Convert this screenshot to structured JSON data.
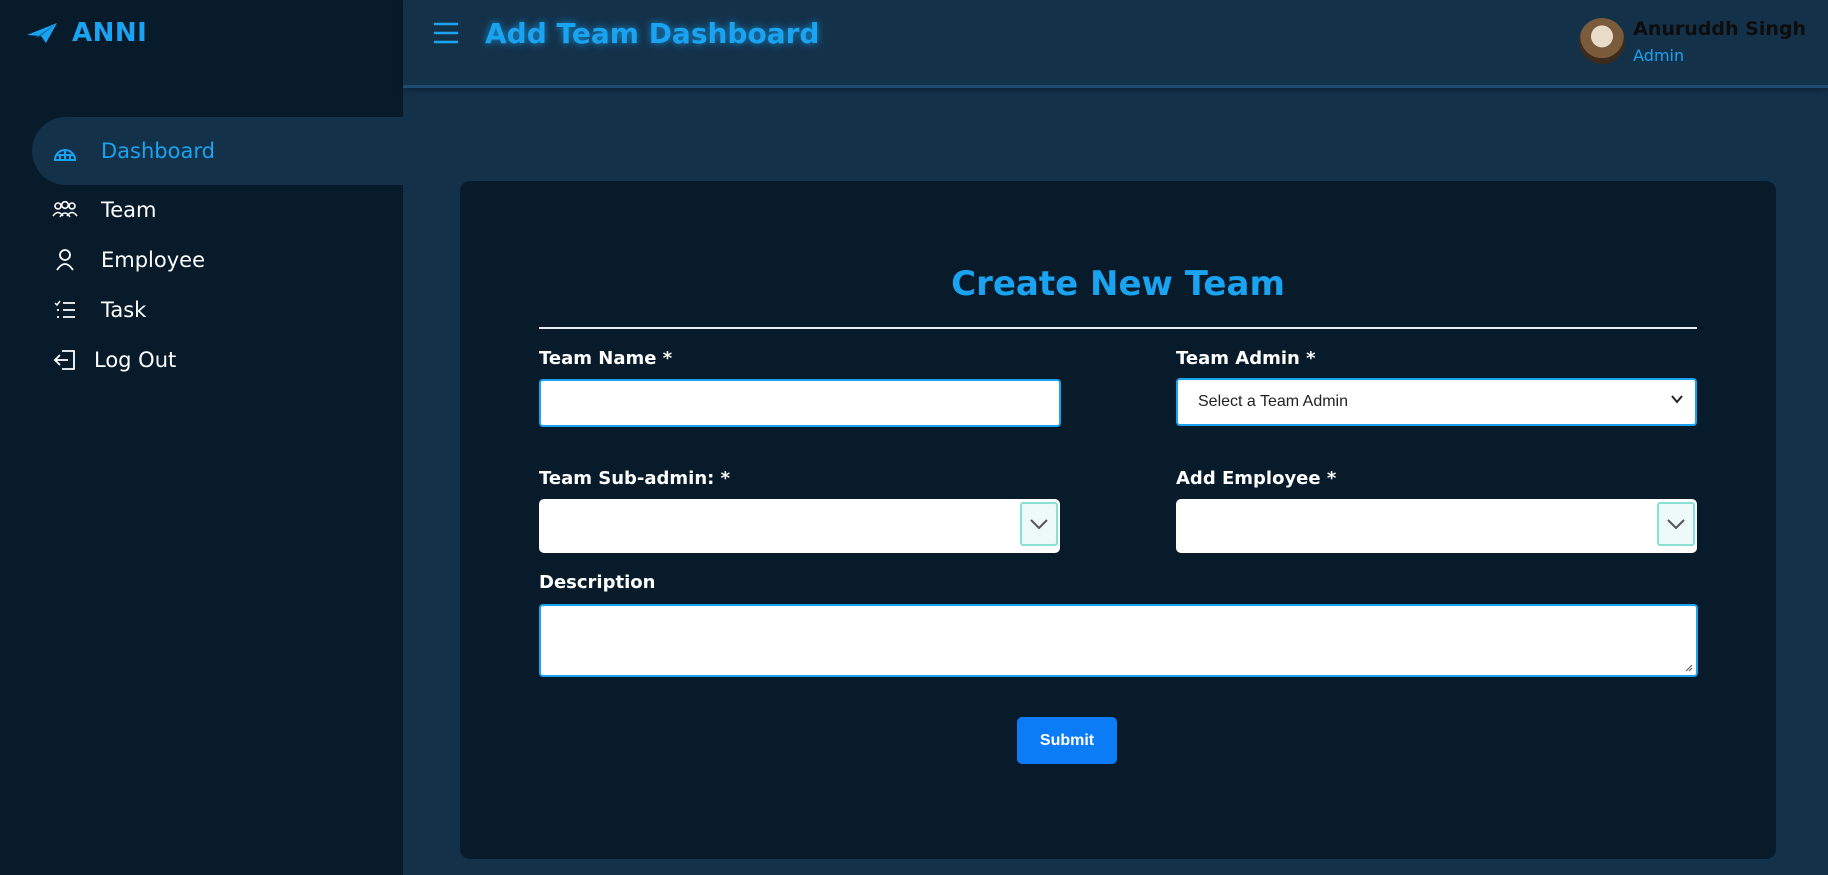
{
  "brand": {
    "name": "ANNI",
    "accent": "#1aa3f0"
  },
  "sidebar": {
    "items": [
      {
        "label": "Dashboard",
        "icon": "dashboard-icon",
        "active": true
      },
      {
        "label": "Team",
        "icon": "team-icon"
      },
      {
        "label": "Employee",
        "icon": "user-icon"
      },
      {
        "label": "Task",
        "icon": "task-list-icon"
      },
      {
        "label": "Log Out",
        "icon": "logout-icon"
      }
    ]
  },
  "header": {
    "title": "Add Team Dashboard",
    "user": {
      "name": "Anuruddh Singh",
      "role": "Admin"
    }
  },
  "form": {
    "title": "Create New Team",
    "team_name": {
      "label": "Team Name *",
      "value": ""
    },
    "team_admin": {
      "label": "Team Admin *",
      "selected": "Select a Team Admin"
    },
    "team_subadmin": {
      "label": "Team Sub-admin: *",
      "value": ""
    },
    "add_employee": {
      "label": "Add Employee *",
      "value": ""
    },
    "description": {
      "label": "Description",
      "value": ""
    },
    "submit_label": "Submit"
  },
  "colors": {
    "background": "#14314a",
    "sidebar": "#081b2b",
    "card": "#081b2b",
    "accent": "#1aa3f0",
    "button": "#0b7cf5"
  }
}
